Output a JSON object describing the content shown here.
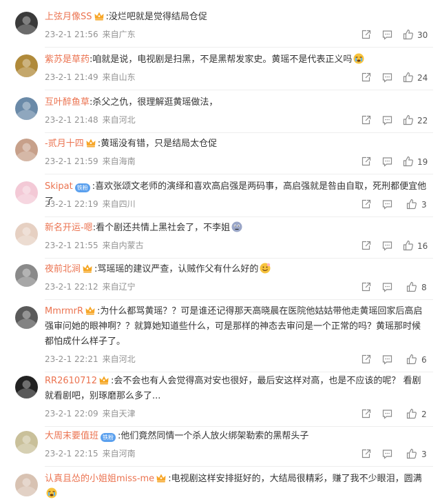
{
  "comments": [
    {
      "user": "上弦月像SS",
      "badge": "crown",
      "text": ":没烂吧就是觉得结局仓促",
      "emoji": "",
      "time": "23-2-1 21:56",
      "location": "来自广东",
      "likes": "30",
      "avatar_color": "#3a3a3a"
    },
    {
      "user": "紫苏是草药",
      "badge": "none",
      "text": ":咱就是说，电视剧是扫黑，不是黑帮发家史。黄瑶不是代表正义吗",
      "emoji": "teary-face",
      "time": "23-2-1 21:49",
      "location": "来自山东",
      "likes": "24",
      "avatar_color": "#b08a3a"
    },
    {
      "user": "互叶醉鱼草",
      "badge": "none",
      "text": ":杀父之仇，很理解逛黄瑶做法，",
      "emoji": "",
      "time": "23-2-1 21:48",
      "location": "来自河北",
      "likes": "22",
      "avatar_color": "#6a8aa8"
    },
    {
      "user": "-贰月十四",
      "badge": "crown",
      "text": ":黄瑶没有错，只是结局太仓促",
      "emoji": "",
      "time": "23-2-1 21:59",
      "location": "来自海南",
      "likes": "19",
      "avatar_color": "#c7a08a"
    },
    {
      "user": "Skipat",
      "badge": "vip",
      "badge_text": "铁粉",
      "text": ":喜欢张颂文老师的演绎和喜欢高启强是两码事，高启强就是咎由自取，死刑都便宜他了",
      "emoji": "",
      "time": "23-2-1 22:19",
      "location": "来自四川",
      "likes": "3",
      "avatar_color": "#f3c9d6"
    },
    {
      "user": "新名开运-嗯",
      "badge": "none",
      "text": ":看个剧还共情上黑社会了，不李姐",
      "emoji": "thinking-face",
      "time": "23-2-1 21:55",
      "location": "来自内蒙古",
      "likes": "16",
      "avatar_color": "#e6d0c2"
    },
    {
      "user": "夜前北涧",
      "badge": "crown-gold",
      "text": ":骂瑶瑶的建议严查，认贼作父有什么好的",
      "emoji": "smile-face",
      "time": "23-2-1 22:12",
      "location": "来自辽宁",
      "likes": "8",
      "avatar_color": "#8a8a8a"
    },
    {
      "user": "MmrmrR",
      "badge": "crown",
      "text": ":为什么都骂黄瑶？？可是谁还记得那天高晓晨在医院他姑姑带他走黄瑶回家后高启强审问她的眼神啊？？就算她知道些什么，可是那样的神态去审问是一个正常的吗？黄瑶那时候都怕成什么样子了。",
      "emoji": "",
      "time": "23-2-1 22:21",
      "location": "来自河北",
      "likes": "6",
      "avatar_color": "#5a5a5a"
    },
    {
      "user": "RR2610712",
      "badge": "crown-gold",
      "text": ":会不会也有人会觉得高对安也很好，最后安这样对高，也是不应该的呢？ 看剧就看剧吧，别琢磨那么多了...",
      "emoji": "",
      "time": "23-2-1 22:09",
      "location": "来自天津",
      "likes": "2",
      "avatar_color": "#222222"
    },
    {
      "user": "大周末要值班",
      "badge": "vip",
      "badge_text": "铁粉",
      "text": ":他们竟然同情一个杀人放火绑架勒索的黑帮头子",
      "emoji": "",
      "time": "23-2-1 22:15",
      "location": "来自河南",
      "likes": "3",
      "avatar_color": "#c9c09a"
    },
    {
      "user": "认真且怂的小姐姐miss-me",
      "badge": "crown",
      "text": ":电视剧这样安排挺好的，大结局很精彩，赚了我不少眼泪，圆满",
      "emoji": "teary-face",
      "time": "",
      "location": "",
      "likes": "",
      "avatar_color": "#d8c2b2"
    }
  ],
  "colors": {
    "username": "#eb7350",
    "meta": "#939393",
    "text": "#333333",
    "divider": "#eeeeee"
  },
  "icons": [
    "repost-icon",
    "comment-icon",
    "like-icon"
  ]
}
